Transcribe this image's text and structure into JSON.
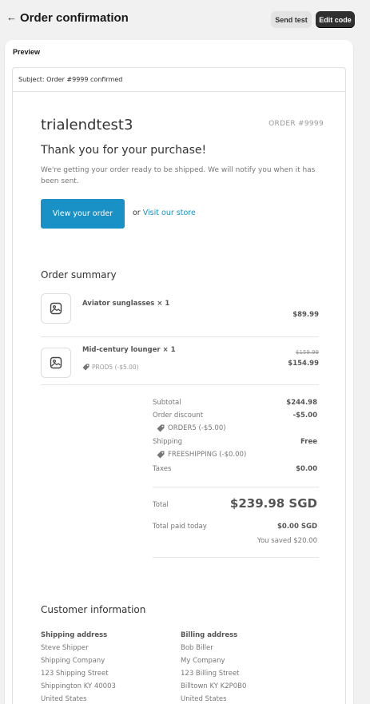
{
  "header": {
    "title": "Order confirmation",
    "back_icon": "←",
    "send_test_label": "Send test",
    "edit_code_label": "Edit code"
  },
  "preview": {
    "label": "Preview",
    "subject": "Subject: Order #9999 confirmed"
  },
  "email": {
    "shop_name": "trialendtest3",
    "order_number": "ORDER #9999",
    "heading": "Thank you for your purchase!",
    "message": "We're getting your order ready to be shipped. We will notify you when it has been sent.",
    "view_order_label": "View your order",
    "or_text": "or ",
    "visit_store_label": "Visit our store",
    "accent_color": "#1990c6"
  },
  "order_summary": {
    "title": "Order summary",
    "items": [
      {
        "name": "Aviator sunglasses × 1",
        "price": "$89.99"
      },
      {
        "name": "Mid-century lounger × 1",
        "original_price": "$159.99",
        "price": "$154.99",
        "discount": "PROD5 (-$5.00)"
      }
    ],
    "totals": {
      "subtotal_label": "Subtotal",
      "subtotal_value": "$244.98",
      "order_discount_label": "Order discount",
      "order_discount_value": "-$5.00",
      "order_discount_code": "ORDER5 (-$5.00)",
      "shipping_label": "Shipping",
      "shipping_value": "Free",
      "shipping_code": "FREESHIPPING (-$0.00)",
      "taxes_label": "Taxes",
      "taxes_value": "$0.00",
      "total_label": "Total",
      "total_value": "$239.98 SGD",
      "paid_label": "Total paid today",
      "paid_value": "$0.00 SGD",
      "saved_text": "You saved $20.00"
    }
  },
  "customer": {
    "title": "Customer information",
    "shipping": {
      "heading": "Shipping address",
      "lines": [
        "Steve Shipper",
        "Shipping Company",
        "123 Shipping Street",
        "Shippington KY 40003",
        "United States"
      ]
    },
    "billing": {
      "heading": "Billing address",
      "lines": [
        "Bob Biller",
        "My Company",
        "123 Billing Street",
        "Billtown KY K2P0B0",
        "United States"
      ]
    }
  }
}
